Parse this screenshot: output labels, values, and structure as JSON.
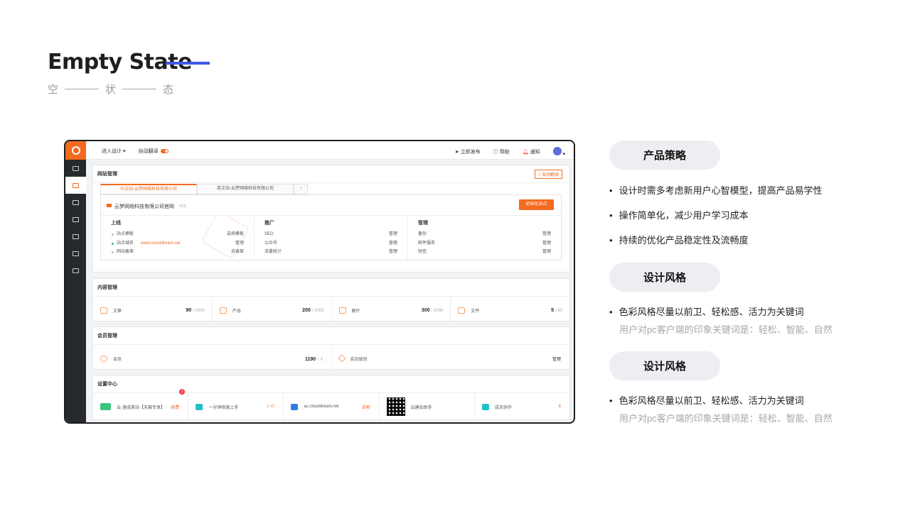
{
  "page": {
    "title": "Empty State",
    "subtitle_chars": [
      "空",
      "状",
      "态"
    ]
  },
  "app": {
    "topbar": {
      "enter_design": "进入设计",
      "auto_translate": "自动翻译",
      "publish": "立即发布",
      "help": "帮助",
      "notify": "通知"
    },
    "site_mgmt": {
      "title": "网站管理",
      "auto_translate_btn": "√ 自动翻译",
      "tabs": [
        "中文站-云梦网络科技有限公司",
        "英文站-云梦网络科技有限公司",
        "+"
      ],
      "site_name": "云梦网络科技有限公司官网",
      "site_lang": "中文",
      "init_btn": "初始化站点",
      "col1": {
        "head": "上线",
        "rows": [
          {
            "k": "站点模板",
            "v": "选择模板"
          },
          {
            "k": "站点域名",
            "link": "www.clouddream.net",
            "v": "管理"
          },
          {
            "k": "网站备案",
            "v": "去备案"
          }
        ]
      },
      "col2": {
        "head": "推广",
        "rows": [
          {
            "k": "SEO",
            "v": "管理"
          },
          {
            "k": "公众号",
            "v": "管理"
          },
          {
            "k": "流量统计",
            "v": "管理"
          }
        ]
      },
      "col3": {
        "head": "管理",
        "rows": [
          {
            "k": "备份",
            "v": "管理"
          },
          {
            "k": "邮件服务",
            "v": "管理"
          },
          {
            "k": "短信",
            "v": "管理"
          }
        ]
      }
    },
    "content_mgmt": {
      "title": "内容管理",
      "items": [
        {
          "label": "文章",
          "value": "90",
          "max": "/ 1000"
        },
        {
          "label": "产品",
          "value": "200",
          "max": "/ 1000"
        },
        {
          "label": "图片",
          "value": "300",
          "max": "/ 1000"
        },
        {
          "label": "文件",
          "value": "5",
          "max": "/ 60"
        }
      ]
    },
    "member_mgmt": {
      "title": "会员管理",
      "items": [
        {
          "label": "会员",
          "value": "1190",
          "max": "/ 人"
        },
        {
          "label": "会员级别",
          "action": "管理"
        }
      ]
    },
    "settings": {
      "title": "设置中心",
      "items": [
        {
          "label": "云·速成美站【天猫专享】",
          "action": "续费",
          "badge": "2"
        },
        {
          "label": "一分钟快速上手",
          "action": "1:49"
        },
        {
          "label": "ac.clouddream.net",
          "action": "说明"
        },
        {
          "label": "云建站助手",
          "action": ""
        },
        {
          "label": "成员协作",
          "action": "6"
        }
      ]
    }
  },
  "right": {
    "sections": [
      {
        "pill": "产品策略",
        "bullets": [
          "设计时需多考虑新用户心智模型，提高产品易学性",
          "操作简单化，减少用户学习成本",
          "持续的优化产品稳定性及流畅度"
        ]
      },
      {
        "pill": "设计风格",
        "bullet": "色彩风格尽量以前卫、轻松感、活力为关键词",
        "note": "用户对pc客户端的印象关键词是：轻松、智能、自然"
      },
      {
        "pill": "设计风格",
        "bullet": "色彩风格尽量以前卫、轻松感、活力为关键词",
        "note": "用户对pc客户端的印象关键词是：轻松、智能、自然"
      }
    ]
  },
  "colors": {
    "accent": "#f46a1f",
    "title_line": "#3d5ae8",
    "pill_bg": "#eceef2",
    "sidebar": "#26292e"
  }
}
